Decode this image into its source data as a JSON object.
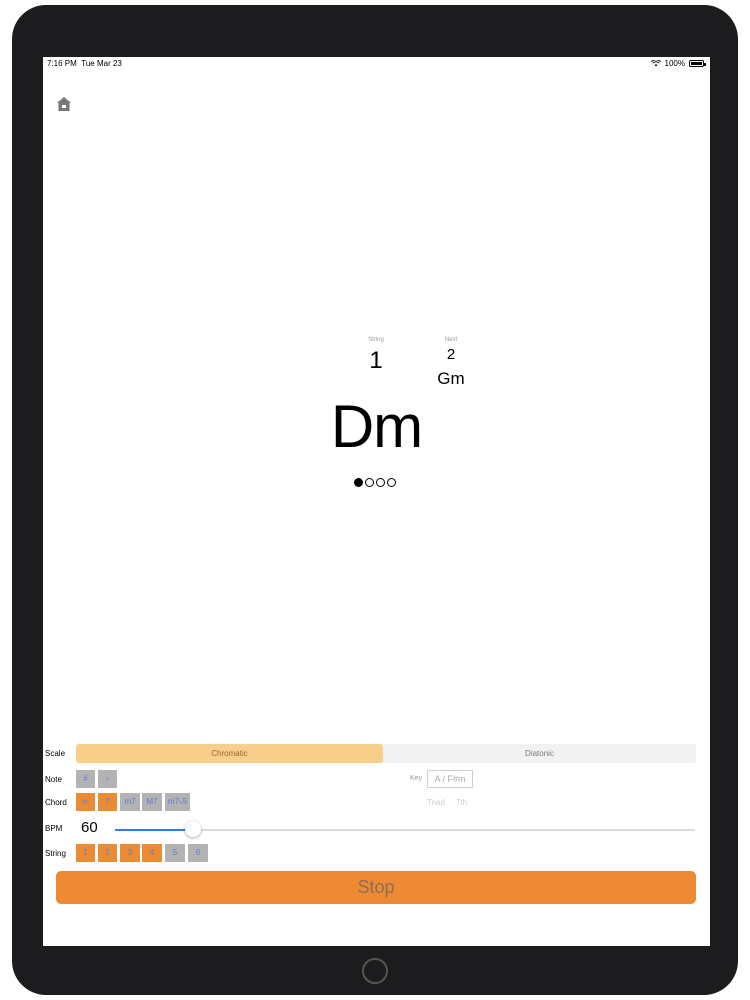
{
  "status": {
    "time": "7:16 PM",
    "date": "Tue Mar 23",
    "battery": "100%"
  },
  "display": {
    "string_label": "String",
    "string_value": "1",
    "next_label": "Next",
    "next_value": "2",
    "next_chord": "Gm",
    "current_chord": "Dm",
    "beat_total": 4,
    "beat_current": 1
  },
  "controls": {
    "scale_label": "Scale",
    "scale_options": [
      "Chromatic",
      "Diatonic"
    ],
    "scale_selected": "Chromatic",
    "note_label": "Note",
    "note_buttons": [
      {
        "label": "#",
        "state": "gray"
      },
      {
        "label": "♭",
        "state": "gray"
      }
    ],
    "key_label": "Key",
    "key_value": "A / F#m",
    "chord_label": "Chord",
    "chord_buttons": [
      {
        "label": "m",
        "state": "orange"
      },
      {
        "label": "7",
        "state": "orange"
      },
      {
        "label": "m7",
        "state": "gray"
      },
      {
        "label": "M7",
        "state": "gray"
      },
      {
        "label": "m7♭5",
        "state": "gray"
      }
    ],
    "triad_label": "Triad",
    "seventh_label": "7th",
    "bpm_label": "BPM",
    "bpm_value": "60",
    "bpm_fraction": 0.135,
    "string_label": "String",
    "string_buttons": [
      {
        "label": "1",
        "state": "orange"
      },
      {
        "label": "2",
        "state": "orange"
      },
      {
        "label": "3",
        "state": "orange"
      },
      {
        "label": "4",
        "state": "orange"
      },
      {
        "label": "5",
        "state": "gray"
      },
      {
        "label": "6",
        "state": "gray"
      }
    ],
    "stop_label": "Stop"
  },
  "colors": {
    "accent": "#ee8a33",
    "slider": "#3478f6",
    "selected_segment": "#f8cf8a"
  }
}
